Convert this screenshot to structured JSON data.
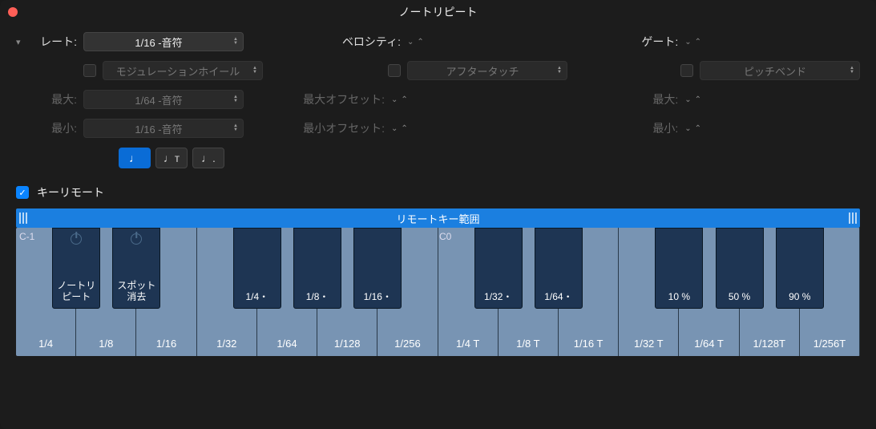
{
  "title": "ノートリピート",
  "rate": {
    "label": "レート:",
    "value": "1/16 -音符",
    "modwheel_label": "モジュレーションホイール",
    "max_label": "最大:",
    "max_value": "1/64 -音符",
    "min_label": "最小:",
    "min_value": "1/16 -音符"
  },
  "velocity": {
    "label": "ベロシティ:",
    "aftertouch_label": "アフタータッチ",
    "max_offset_label": "最大オフセット:",
    "min_offset_label": "最小オフセット:"
  },
  "gate": {
    "label": "ゲート:",
    "pitchbend_label": "ピッチベンド",
    "max_label": "最大:",
    "min_label": "最小:"
  },
  "note_buttons": {
    "plain": "♩",
    "triplet": "♩ᴛ",
    "dotted": "♩."
  },
  "remote": {
    "checkbox_label": "キーリモート",
    "range_label": "リモートキー範囲",
    "octaves": {
      "c_1": "C-1",
      "c0": "C0"
    }
  },
  "white_keys": [
    "1/4",
    "1/8",
    "1/16",
    "1/32",
    "1/64",
    "1/128",
    "1/256",
    "1/4 T",
    "1/8 T",
    "1/16 T",
    "1/32 T",
    "1/64 T",
    "1/128T",
    "1/256T"
  ],
  "black_keys": [
    {
      "pos": 0,
      "top": "power",
      "label": "ノートリ\nピート"
    },
    {
      "pos": 1,
      "top": "power",
      "label": "スポット\n消去"
    },
    {
      "pos": 3,
      "top": "",
      "label": "1/4・"
    },
    {
      "pos": 4,
      "top": "",
      "label": "1/8・"
    },
    {
      "pos": 5,
      "top": "",
      "label": "1/16・"
    },
    {
      "pos": 7,
      "top": "",
      "label": "1/32・"
    },
    {
      "pos": 8,
      "top": "",
      "label": "1/64・"
    },
    {
      "pos": 10,
      "top": "",
      "label": "10 %"
    },
    {
      "pos": 11,
      "top": "",
      "label": "50 %"
    },
    {
      "pos": 12,
      "top": "",
      "label": "90 %"
    }
  ]
}
